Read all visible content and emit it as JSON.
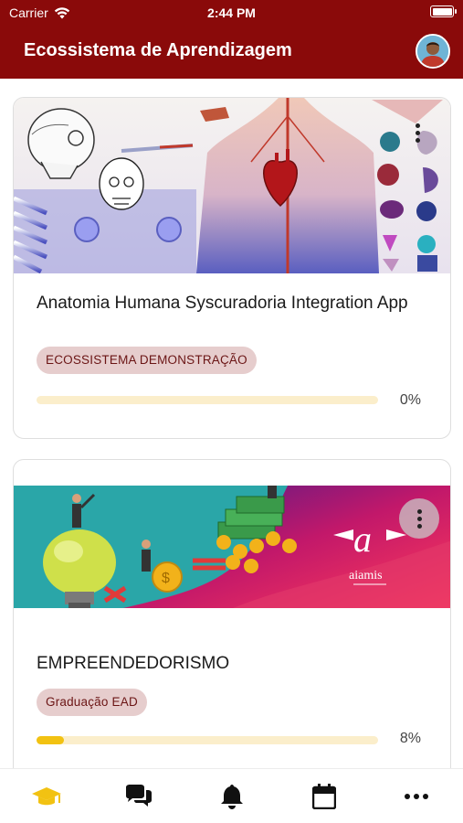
{
  "status_bar": {
    "carrier": "Carrier",
    "time": "2:44 PM"
  },
  "header": {
    "title": "Ecossistema de Aprendizagem"
  },
  "courses": [
    {
      "title": "Anatomia Humana Syscuradoria Integration App",
      "tag": "ECOSSISTEMA DEMONSTRAÇÃO",
      "progress_label": "0%",
      "progress": 0,
      "image": "human-anatomy-illustration"
    },
    {
      "title": "EMPREENDEDORISMO",
      "tag": "Graduação EAD",
      "progress_label": "8%",
      "progress": 8,
      "image": "entrepreneurship-illustration",
      "logo_text": "aiamis"
    }
  ],
  "tab_bar": {
    "items": [
      {
        "icon": "graduation-cap-icon",
        "active": true
      },
      {
        "icon": "chat-bubbles-icon",
        "active": false
      },
      {
        "icon": "bell-icon",
        "active": false
      },
      {
        "icon": "calendar-icon",
        "active": false
      },
      {
        "icon": "more-icon",
        "active": false
      }
    ]
  },
  "colors": {
    "brand": "#8a0a0a",
    "accent": "#f2c212",
    "tag_bg": "#e6cdcd",
    "tag_text": "#6b1515"
  }
}
